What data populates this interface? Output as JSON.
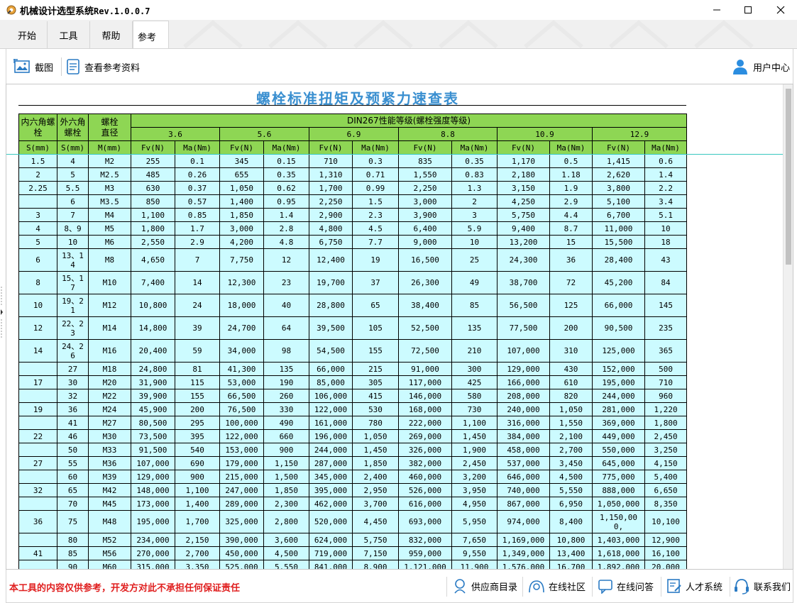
{
  "window": {
    "title": "机械设计选型系统",
    "version": "Rev.1.0.0.7"
  },
  "tabs": [
    {
      "label": "开始",
      "active": false
    },
    {
      "label": "工具",
      "active": false
    },
    {
      "label": "帮助",
      "active": false
    },
    {
      "label": "参考",
      "active": true
    }
  ],
  "toolbar": {
    "screenshot_label": "截图",
    "view_reference_label": "查看参考资料",
    "user_center_label": "用户中心"
  },
  "document": {
    "title": "螺栓标准扭矩及预紧力速查表",
    "group_header": "DIN267性能等级(螺栓强度等级)",
    "col_socket": "内六角螺栓",
    "col_hex": "外六角螺栓",
    "col_dia": "螺栓直径",
    "unit_s": "S(mm)",
    "unit_m": "M(mm)",
    "unit_fv": "Fv(N)",
    "unit_ma": "Ma(Nm)",
    "grades": [
      "3.6",
      "5.6",
      "6.9",
      "8.8",
      "10.9",
      "12.9"
    ],
    "rows": [
      {
        "s1": "1.5",
        "s2": "4",
        "m": "M2",
        "v": [
          "255",
          "0.1",
          "345",
          "0.15",
          "710",
          "0.3",
          "835",
          "0.35",
          "1,170",
          "0.5",
          "1,415",
          "0.6"
        ]
      },
      {
        "s1": "2",
        "s2": "5",
        "m": "M2.5",
        "v": [
          "485",
          "0.26",
          "655",
          "0.35",
          "1,310",
          "0.71",
          "1,550",
          "0.83",
          "2,180",
          "1.18",
          "2,620",
          "1.4"
        ]
      },
      {
        "s1": "2.25",
        "s2": "5.5",
        "m": "M3",
        "v": [
          "630",
          "0.37",
          "1,050",
          "0.62",
          "1,700",
          "0.99",
          "2,250",
          "1.3",
          "3,150",
          "1.9",
          "3,800",
          "2.2"
        ]
      },
      {
        "s1": "",
        "s2": "6",
        "m": "M3.5",
        "v": [
          "850",
          "0.57",
          "1,400",
          "0.95",
          "2,250",
          "1.5",
          "3,000",
          "2",
          "4,250",
          "2.9",
          "5,100",
          "3.4"
        ]
      },
      {
        "s1": "3",
        "s2": "7",
        "m": "M4",
        "v": [
          "1,100",
          "0.85",
          "1,850",
          "1.4",
          "2,900",
          "2.3",
          "3,900",
          "3",
          "5,750",
          "4.4",
          "6,700",
          "5.1"
        ]
      },
      {
        "s1": "4",
        "s2": "8、9",
        "m": "M5",
        "v": [
          "1,800",
          "1.7",
          "3,000",
          "2.8",
          "4,800",
          "4.5",
          "6,400",
          "5.9",
          "9,400",
          "8.7",
          "11,000",
          "10"
        ]
      },
      {
        "s1": "5",
        "s2": "10",
        "m": "M6",
        "v": [
          "2,550",
          "2.9",
          "4,200",
          "4.8",
          "6,750",
          "7.7",
          "9,000",
          "10",
          "13,200",
          "15",
          "15,500",
          "18"
        ]
      },
      {
        "s1": "6",
        "s2": "13、14",
        "m": "M8",
        "v": [
          "4,650",
          "7",
          "7,750",
          "12",
          "12,400",
          "19",
          "16,500",
          "25",
          "24,300",
          "36",
          "28,400",
          "43"
        ]
      },
      {
        "s1": "8",
        "s2": "15、17",
        "m": "M10",
        "v": [
          "7,400",
          "14",
          "12,300",
          "23",
          "19,700",
          "37",
          "26,300",
          "49",
          "38,700",
          "72",
          "45,200",
          "84"
        ]
      },
      {
        "s1": "10",
        "s2": "19、21",
        "m": "M12",
        "v": [
          "10,800",
          "24",
          "18,000",
          "40",
          "28,800",
          "65",
          "38,400",
          "85",
          "56,500",
          "125",
          "66,000",
          "145"
        ]
      },
      {
        "s1": "12",
        "s2": "22、23",
        "m": "M14",
        "v": [
          "14,800",
          "39",
          "24,700",
          "64",
          "39,500",
          "105",
          "52,500",
          "135",
          "77,500",
          "200",
          "90,500",
          "235"
        ]
      },
      {
        "s1": "14",
        "s2": "24、26",
        "m": "M16",
        "v": [
          "20,400",
          "59",
          "34,000",
          "98",
          "54,500",
          "155",
          "72,500",
          "210",
          "107,000",
          "310",
          "125,000",
          "365"
        ]
      },
      {
        "s1": "",
        "s2": "27",
        "m": "M18",
        "v": [
          "24,800",
          "81",
          "41,300",
          "135",
          "66,000",
          "215",
          "91,000",
          "300",
          "129,000",
          "430",
          "152,000",
          "500"
        ]
      },
      {
        "s1": "17",
        "s2": "30",
        "m": "M20",
        "v": [
          "31,900",
          "115",
          "53,000",
          "190",
          "85,000",
          "305",
          "117,000",
          "425",
          "166,000",
          "610",
          "195,000",
          "710"
        ]
      },
      {
        "s1": "",
        "s2": "32",
        "m": "M22",
        "v": [
          "39,900",
          "155",
          "66,500",
          "260",
          "106,000",
          "415",
          "146,000",
          "580",
          "208,000",
          "820",
          "244,000",
          "960"
        ]
      },
      {
        "s1": "19",
        "s2": "36",
        "m": "M24",
        "v": [
          "45,900",
          "200",
          "76,500",
          "330",
          "122,000",
          "530",
          "168,000",
          "730",
          "240,000",
          "1,050",
          "281,000",
          "1,220"
        ]
      },
      {
        "s1": "",
        "s2": "41",
        "m": "M27",
        "v": [
          "80,500",
          "295",
          "100,000",
          "490",
          "161,000",
          "780",
          "222,000",
          "1,100",
          "316,000",
          "1,550",
          "369,000",
          "1,800"
        ]
      },
      {
        "s1": "22",
        "s2": "46",
        "m": "M30",
        "v": [
          "73,500",
          "395",
          "122,000",
          "660",
          "196,000",
          "1,050",
          "269,000",
          "1,450",
          "384,000",
          "2,100",
          "449,000",
          "2,450"
        ]
      },
      {
        "s1": "",
        "s2": "50",
        "m": "M33",
        "v": [
          "91,500",
          "540",
          "153,000",
          "900",
          "244,000",
          "1,450",
          "326,000",
          "1,900",
          "458,000",
          "2,700",
          "550,000",
          "3,250"
        ]
      },
      {
        "s1": "27",
        "s2": "55",
        "m": "M36",
        "v": [
          "107,000",
          "690",
          "179,000",
          "1,150",
          "287,000",
          "1,850",
          "382,000",
          "2,450",
          "537,000",
          "3,450",
          "645,000",
          "4,150"
        ]
      },
      {
        "s1": "",
        "s2": "60",
        "m": "M39",
        "v": [
          "129,000",
          "900",
          "215,000",
          "1,500",
          "345,000",
          "2,400",
          "460,000",
          "3,200",
          "646,000",
          "4,500",
          "775,000",
          "5,400"
        ]
      },
      {
        "s1": "32",
        "s2": "65",
        "m": "M42",
        "v": [
          "148,000",
          "1,100",
          "247,000",
          "1,850",
          "395,000",
          "2,950",
          "526,000",
          "3,950",
          "740,000",
          "5,550",
          "888,000",
          "6,650"
        ]
      },
      {
        "s1": "",
        "s2": "70",
        "m": "M45",
        "v": [
          "173,000",
          "1,400",
          "289,000",
          "2,300",
          "462,000",
          "3,700",
          "616,000",
          "4,950",
          "867,000",
          "6,950",
          "1,050,000",
          "8,350"
        ]
      },
      {
        "s1": "36",
        "s2": "75",
        "m": "M48",
        "v": [
          "195,000",
          "1,700",
          "325,000",
          "2,800",
          "520,000",
          "4,450",
          "693,000",
          "5,950",
          "974,000",
          "8,400",
          "1,150,000,",
          "10,100"
        ]
      },
      {
        "s1": "",
        "s2": "80",
        "m": "M52",
        "v": [
          "234,000",
          "2,150",
          "390,000",
          "3,600",
          "624,000",
          "5,750",
          "832,000",
          "7,650",
          "1,169,000",
          "10,800",
          "1,403,000",
          "12,900"
        ]
      },
      {
        "s1": "41",
        "s2": "85",
        "m": "M56",
        "v": [
          "270,000",
          "2,700",
          "450,000",
          "4,500",
          "719,000",
          "7,150",
          "959,000",
          "9,550",
          "1,349,000",
          "13,400",
          "1,618,000",
          "16,100"
        ]
      },
      {
        "s1": "",
        "s2": "90",
        "m": "M60",
        "v": [
          "315,000",
          "3,350",
          "525,000",
          "5,550",
          "841,000",
          "8,900",
          "1,121,000",
          "11,900",
          "1,576,000",
          "16,700",
          "1,892,000",
          "20,000"
        ]
      }
    ]
  },
  "statusbar": {
    "disclaimer": "本工具的内容仅供参考，开发方对此不承担任何保证责任",
    "links": [
      "供应商目录",
      "在线社区",
      "在线问答",
      "人才系统",
      "联系我们"
    ]
  },
  "colors": {
    "header_green": "#8ed654",
    "cell_cyan": "#ccfbff",
    "title_blue": "#3a8fd0",
    "disclaimer_red": "#e02020",
    "user_blue": "#2b8de0"
  }
}
